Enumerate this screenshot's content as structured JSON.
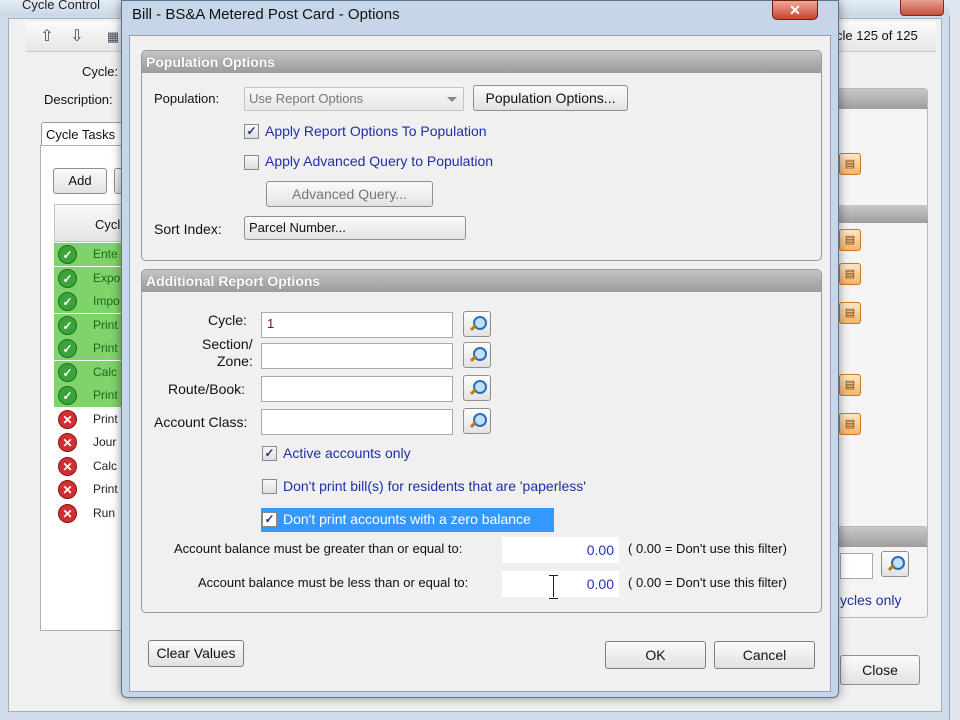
{
  "background": {
    "window_title": "Cycle Control",
    "cycle_counter": "cle 125 of 125",
    "cycle_label": "Cycle:",
    "description_label": "Description:",
    "tab_label": "Cycle Tasks",
    "add_label": "Add",
    "grid_header": "Cycl",
    "tasks": [
      {
        "text": "Ente",
        "status": "ok"
      },
      {
        "text": "Expo",
        "status": "ok"
      },
      {
        "text": "Impo",
        "status": "ok"
      },
      {
        "text": "Print",
        "status": "ok"
      },
      {
        "text": "Print",
        "status": "ok"
      },
      {
        "text": "Calc",
        "status": "ok"
      },
      {
        "text": "Print",
        "status": "ok"
      },
      {
        "text": "Print",
        "status": "error"
      },
      {
        "text": "Jour",
        "status": "error"
      },
      {
        "text": "Calc",
        "status": "error"
      },
      {
        "text": "Print",
        "status": "error"
      },
      {
        "text": "Run",
        "status": "error"
      }
    ],
    "cycles_only_text": "ycles only",
    "close_label": "Close"
  },
  "dialog": {
    "title": "Bill - BS&A Metered Post Card -  Options",
    "close_glyph": "✕",
    "population_group_title": "Population Options",
    "population_label": "Population:",
    "population_value": "Use Report Options",
    "population_options_btn": "Population Options...",
    "apply_report_options": {
      "label": "Apply Report Options To Population",
      "checked": true
    },
    "apply_advanced_query": {
      "label": "Apply Advanced Query to Population",
      "checked": false
    },
    "advanced_query_btn": "Advanced Query...",
    "sort_index_label": "Sort Index:",
    "sort_index_value": "Parcel Number...",
    "additional_group_title": "Additional Report Options",
    "cycle_label": "Cycle:",
    "cycle_value": "1",
    "section_label_1": "Section/",
    "section_label_2": "Zone:",
    "section_value": "",
    "route_label": "Route/Book:",
    "route_value": "",
    "account_class_label": "Account Class:",
    "account_class_value": "",
    "active_accounts": {
      "label": "Active accounts only",
      "checked": true
    },
    "paperless": {
      "label": "Don't print bill(s) for residents that are 'paperless'",
      "checked": false
    },
    "zero_balance": {
      "label": "Don't print accounts with a zero balance",
      "checked": true
    },
    "gte_label": "Account balance must be greater than or equal to:",
    "gte_value": "0.00",
    "gte_note": "( 0.00 = Don't use this filter)",
    "lte_label": "Account balance must be less than or equal to:",
    "lte_value": "0.00",
    "lte_note": "( 0.00 = Don't use this filter)",
    "clear_values_btn": "Clear Values",
    "ok_btn": "OK",
    "cancel_btn": "Cancel"
  },
  "colors": {
    "ok_row": "#7fd36a",
    "error_icon": "#d23030",
    "link_blue": "#1f2ea8",
    "selection": "#3399ff"
  }
}
